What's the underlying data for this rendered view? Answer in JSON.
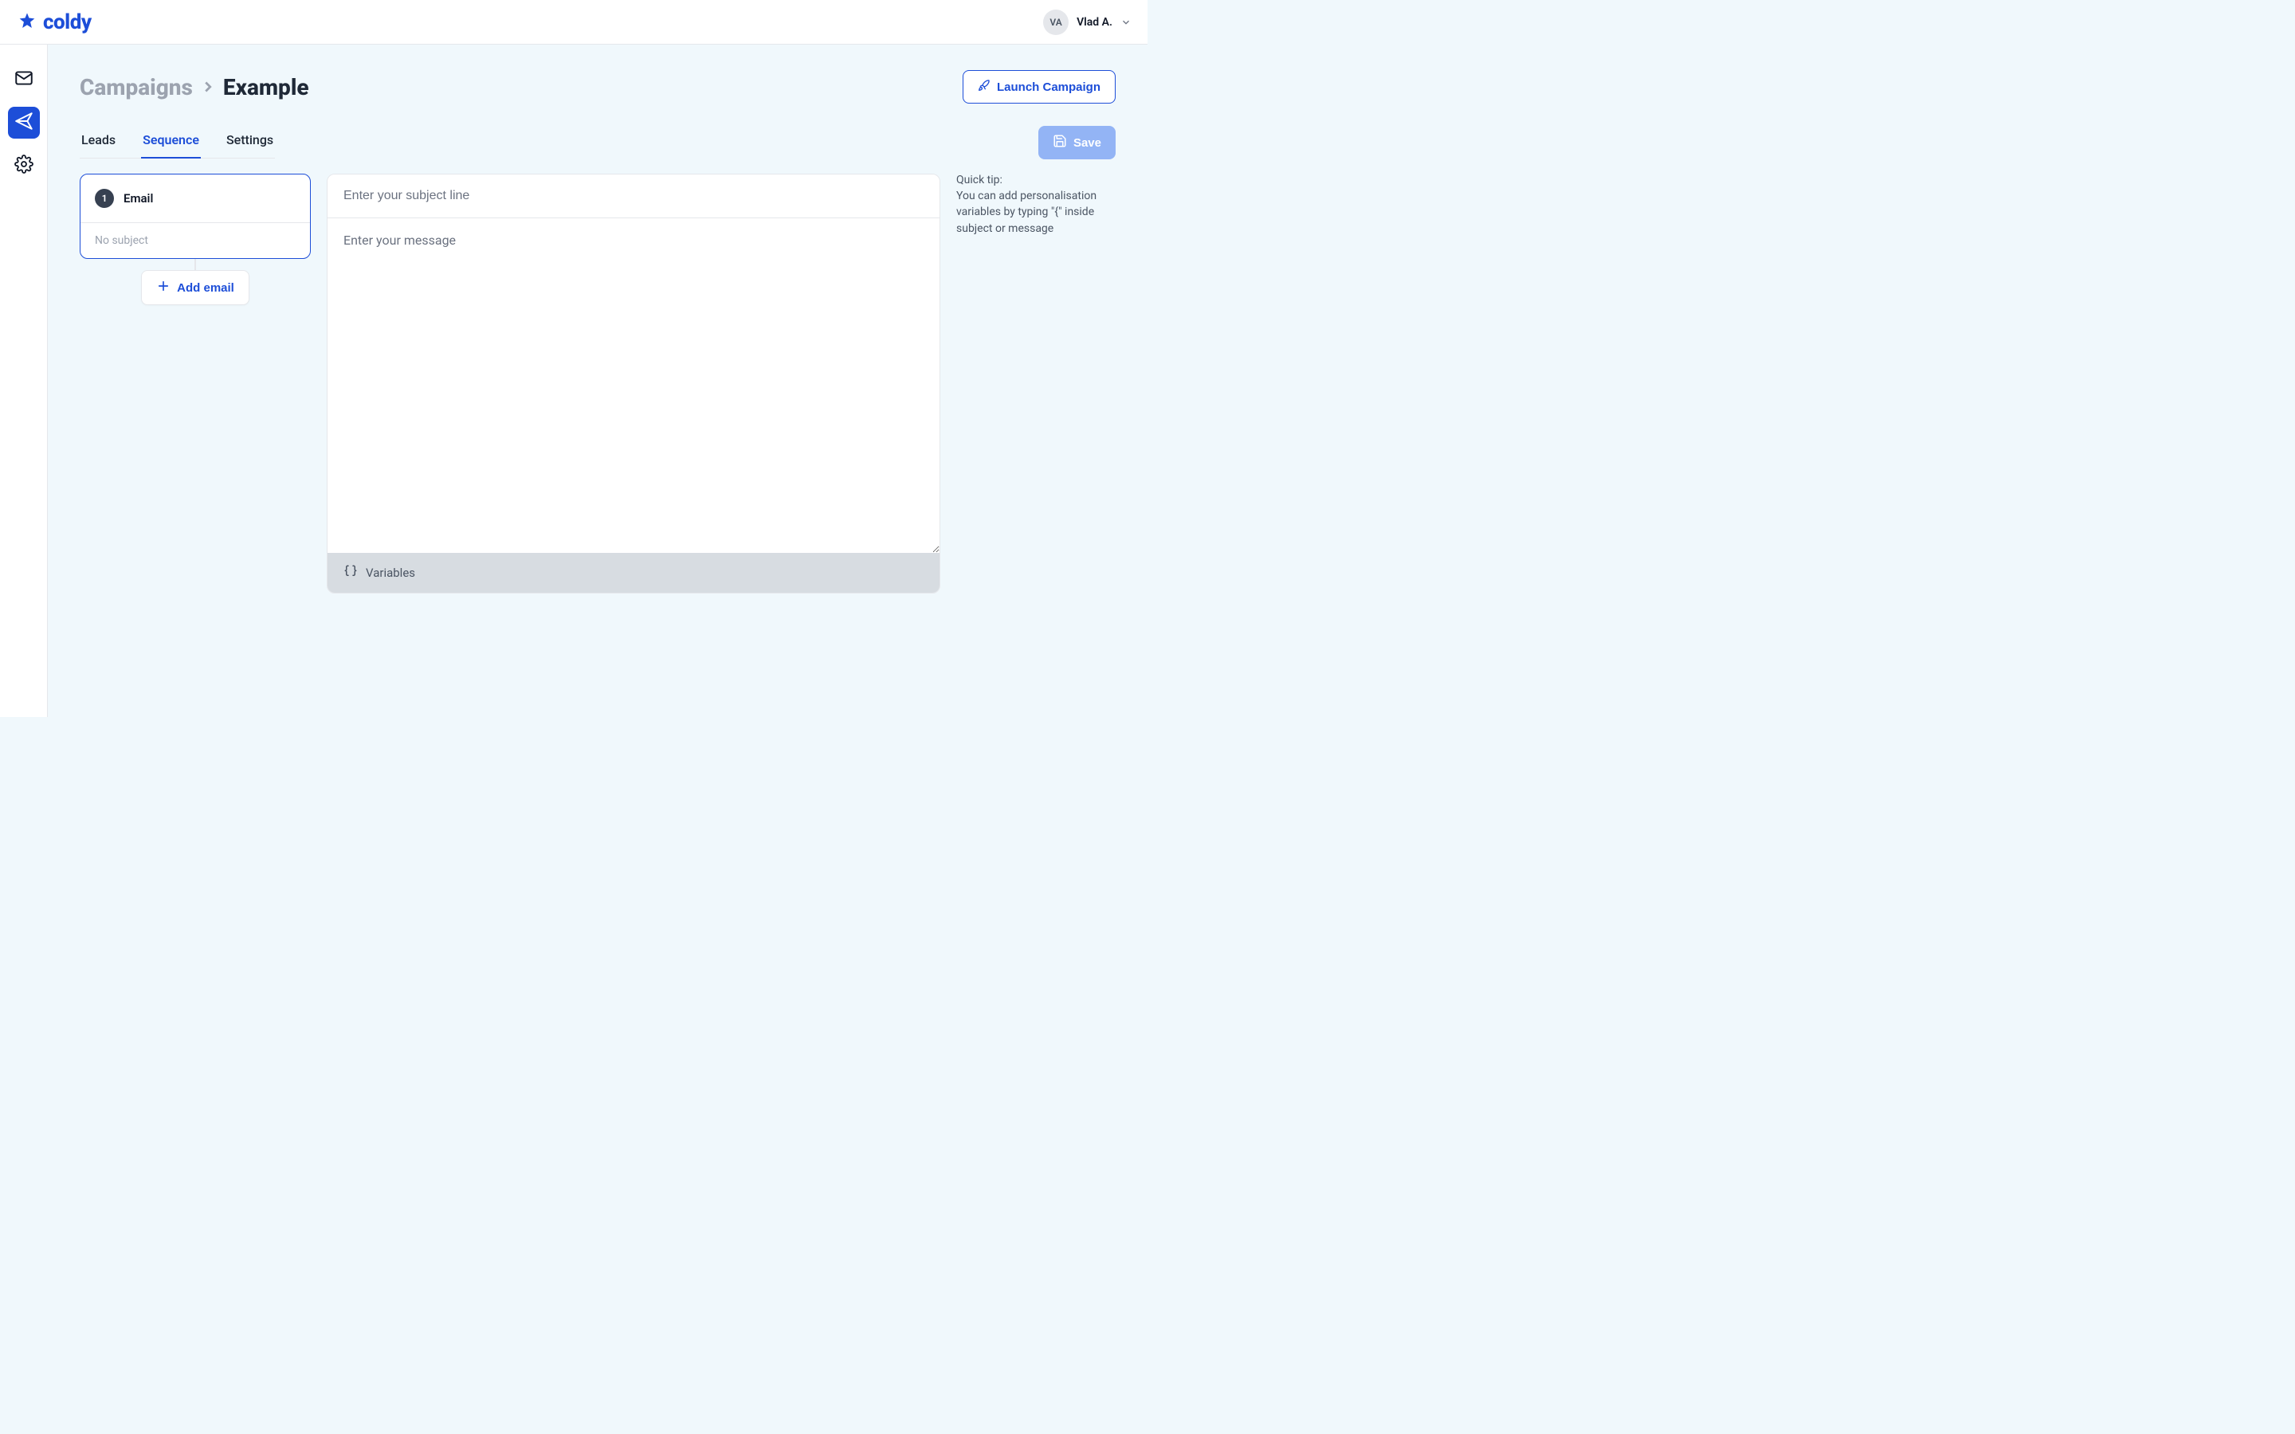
{
  "brand": {
    "name": "coldy"
  },
  "user": {
    "initials": "VA",
    "name": "Vlad A."
  },
  "sidebar": {
    "items": [
      {
        "id": "inbox",
        "icon": "mail-icon"
      },
      {
        "id": "campaigns",
        "icon": "send-icon"
      },
      {
        "id": "settings",
        "icon": "gear-icon"
      }
    ],
    "active": "campaigns"
  },
  "breadcrumb": {
    "root": "Campaigns",
    "current": "Example"
  },
  "actions": {
    "launch": "Launch Campaign",
    "save": "Save"
  },
  "tabs": [
    {
      "id": "leads",
      "label": "Leads"
    },
    {
      "id": "sequence",
      "label": "Sequence"
    },
    {
      "id": "settings",
      "label": "Settings"
    }
  ],
  "active_tab": "sequence",
  "sequence": {
    "steps": [
      {
        "index": "1",
        "type": "Email",
        "subject_preview": "No subject"
      }
    ],
    "add_label": "Add email"
  },
  "editor": {
    "subject_placeholder": "Enter your subject line",
    "message_placeholder": "Enter your message",
    "variables_label": "Variables"
  },
  "tip": {
    "title": "Quick tip:",
    "text": "You can add personalisation variables by typing \"{\" inside subject or message"
  }
}
